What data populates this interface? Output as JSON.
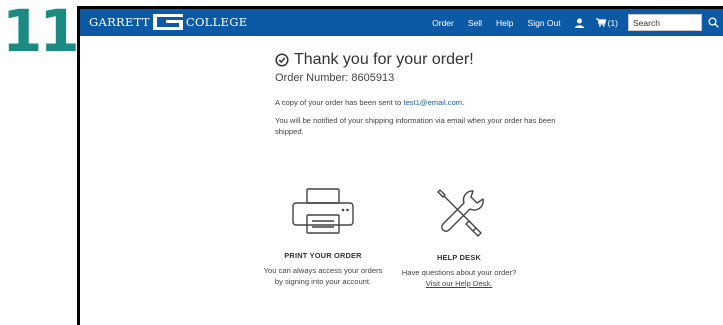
{
  "step_number": "11",
  "brand": {
    "left": "GARRETT",
    "right": "COLLEGE",
    "accent": "#0c5aa6"
  },
  "nav": {
    "items": [
      "Order",
      "Sell",
      "Help",
      "Sign Out"
    ],
    "account_icon": "user-icon",
    "cart_icon": "cart-icon",
    "cart_count": "(1)",
    "search_placeholder": "Search",
    "search_icon": "search-icon"
  },
  "confirmation": {
    "title": "Thank you for your order!",
    "title_icon": "check-circle-icon",
    "order_number": "Order Number: 8605913",
    "copy_prefix": "A copy of your order has been sent to ",
    "email": "test1@email.com",
    "copy_suffix": ".",
    "notify": "You will be notified of your shipping information via email when your order has been shipped."
  },
  "cards": {
    "print": {
      "icon": "printer-icon",
      "title": "PRINT YOUR ORDER",
      "line1": "You can always access your orders",
      "line2": "by signing into your account."
    },
    "help": {
      "icon": "tools-icon",
      "title": "HELP DESK",
      "line1": "Have questions about your order?",
      "link": "Visit our Help Desk."
    }
  }
}
